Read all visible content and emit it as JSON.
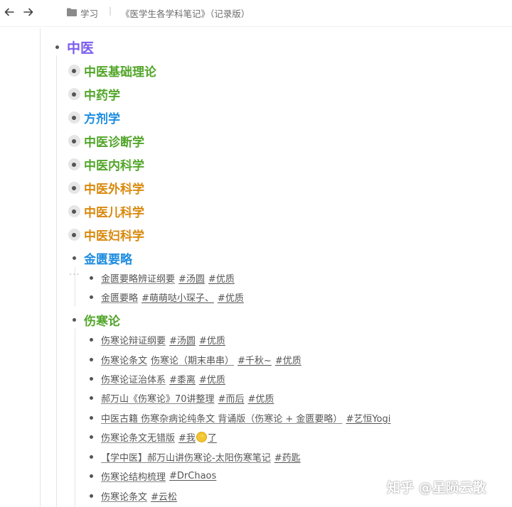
{
  "colors": {
    "purple": "#7b5cf0",
    "green": "#52a62a",
    "blue": "#1f8de0",
    "orange": "#d9890c",
    "leaf": "#555555"
  },
  "topbar": {
    "back_icon": "arrow-left-icon",
    "forward_icon": "arrow-right-icon",
    "folder_icon": "folder-icon",
    "crumb_parent": "学习",
    "crumb_sep": "|",
    "crumb_current": "《医学生各学科笔记》（记录版）"
  },
  "outline": {
    "root": "中医",
    "sections": [
      {
        "label": "中医基础理论",
        "color": "green"
      },
      {
        "label": "中药学",
        "color": "green"
      },
      {
        "label": "方剂学",
        "color": "blue"
      },
      {
        "label": "中医诊断学",
        "color": "green"
      },
      {
        "label": "中医内科学",
        "color": "green"
      },
      {
        "label": "中医外科学",
        "color": "orange"
      },
      {
        "label": "中医儿科学",
        "color": "orange"
      },
      {
        "label": "中医妇科学",
        "color": "orange"
      }
    ],
    "jingui": {
      "label": "金匮要略",
      "more": "···",
      "items": [
        {
          "text": "金匮要略辨证纲要",
          "tags": [
            "#汤圆",
            "#优质"
          ]
        },
        {
          "text": "金匮要略",
          "tags": [
            "#萌萌哒小琛子、",
            "#优质"
          ]
        }
      ]
    },
    "shanghan": {
      "label": "伤寒论",
      "items": [
        {
          "text": "伤寒论辩证纲要",
          "tags": [
            "#汤圆",
            "#优质"
          ]
        },
        {
          "text": "伤寒论条文",
          "extra": "伤寒论（期末串串）",
          "tags": [
            "#千秋~",
            "#优质"
          ]
        },
        {
          "text": "伤寒论证治体系",
          "tags": [
            "#黍离",
            "#优质"
          ]
        },
        {
          "text": "郝万山《伤寒论》70讲整理",
          "tags": [
            "#而后",
            "#优质"
          ]
        },
        {
          "text": "中医古籍 伤寒杂病论纯条文 背诵版（伤寒论 + 金匮要略）",
          "tags": [
            "#艺恒Yogi"
          ]
        },
        {
          "text": "伤寒论条文无错版",
          "tag_pre": "#我",
          "tag_post": "了"
        },
        {
          "text": "【学中医】郝万山讲伤寒论-太阳伤寒笔记",
          "tags": [
            "#药匙"
          ]
        },
        {
          "text": "伤寒论结构梳理",
          "tags": [
            "#DrChaos"
          ]
        },
        {
          "text": "伤寒论条文",
          "tags": [
            "#云松"
          ]
        }
      ]
    }
  },
  "watermark": "知乎 @星陨云散"
}
